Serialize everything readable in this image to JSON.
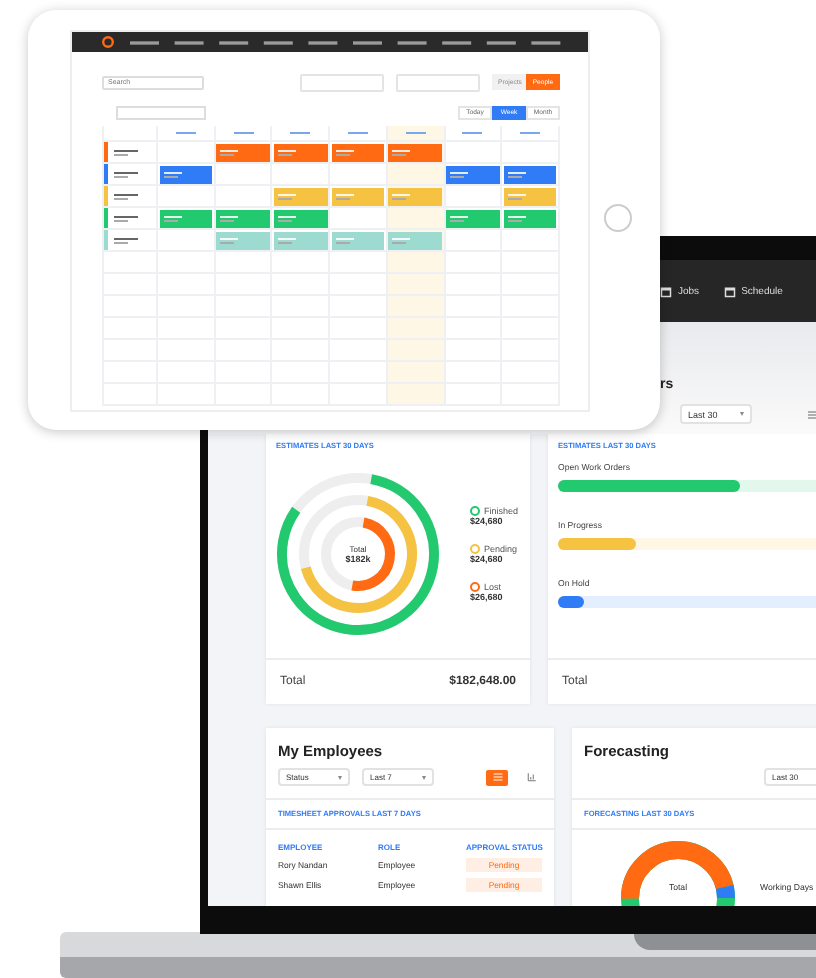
{
  "tablet": {
    "search": {
      "placeholder": "Search"
    },
    "toggle": [
      {
        "label": "Projects",
        "selected": false
      },
      {
        "label": "People",
        "selected": true
      }
    ],
    "views": [
      {
        "label": "Today",
        "selected": false
      },
      {
        "label": "Week",
        "selected": true
      },
      {
        "label": "Month",
        "selected": false
      }
    ],
    "day_columns": [
      {
        "today": false
      },
      {
        "today": false
      },
      {
        "today": false
      },
      {
        "today": false
      },
      {
        "today": true
      },
      {
        "today": false
      },
      {
        "today": false
      }
    ],
    "rows": [
      {
        "color": "#ff6a13",
        "days": [
          false,
          true,
          true,
          true,
          true,
          false,
          false
        ]
      },
      {
        "color": "#2f7cf6",
        "days": [
          true,
          false,
          false,
          false,
          false,
          true,
          true
        ]
      },
      {
        "color": "#f5c242",
        "days": [
          false,
          false,
          true,
          true,
          true,
          false,
          true
        ]
      },
      {
        "color": "#22c96e",
        "days": [
          true,
          true,
          true,
          false,
          false,
          true,
          true
        ]
      },
      {
        "color": "#9ddbd0",
        "days": [
          false,
          true,
          true,
          true,
          true,
          false,
          false
        ]
      }
    ]
  },
  "laptop": {
    "nav": [
      "Jobs",
      "Schedule"
    ],
    "header": {
      "title": "rs",
      "range": "Last 30"
    },
    "estimates": {
      "title": "ESTIMATES LAST 30 DAYS",
      "center_label": "Total",
      "center_value": "$182k",
      "segments": [
        {
          "name": "Finished",
          "value": "$24,680",
          "color": "#22c96e",
          "level": 0.82
        },
        {
          "name": "Pending",
          "value": "$24,680",
          "color": "#f5c242",
          "level": 0.68
        },
        {
          "name": "Lost",
          "value": "$26,680",
          "color": "#ff6a13",
          "level": 0.5
        }
      ],
      "total_label": "Total",
      "total_value": "$182,648.00"
    },
    "work_orders": {
      "title": "ESTIMATES LAST 30 DAYS",
      "bars": [
        {
          "label": "Open Work Orders",
          "color": "#22c96e",
          "level": 0.65
        },
        {
          "label": "In Progress",
          "color": "#f5c242",
          "level": 0.28
        },
        {
          "label": "On Hold",
          "color": "#2f7cf6",
          "level": 0.09
        }
      ],
      "total_label": "Total"
    },
    "employees": {
      "title": "My Employees",
      "filters": [
        "Status",
        "Last 7"
      ],
      "views": [
        {
          "kind": "list",
          "selected": true
        },
        {
          "kind": "chart",
          "selected": false
        }
      ],
      "section": "TIMESHEET APPROVALS LAST 7 DAYS",
      "columns": [
        "EMPLOYEE",
        "ROLE",
        "APPROVAL STATUS"
      ],
      "rows": [
        {
          "name": "Rory Nandan",
          "role": "Employee",
          "status": "Pending"
        },
        {
          "name": "Shawn Ellis",
          "role": "Employee",
          "status": "Pending"
        }
      ]
    },
    "forecasting": {
      "title": "Forecasting",
      "range": "Last 30",
      "section": "FORECASTING LAST 30 DAYS",
      "center_label": "Total",
      "legend": "Working Days"
    }
  }
}
